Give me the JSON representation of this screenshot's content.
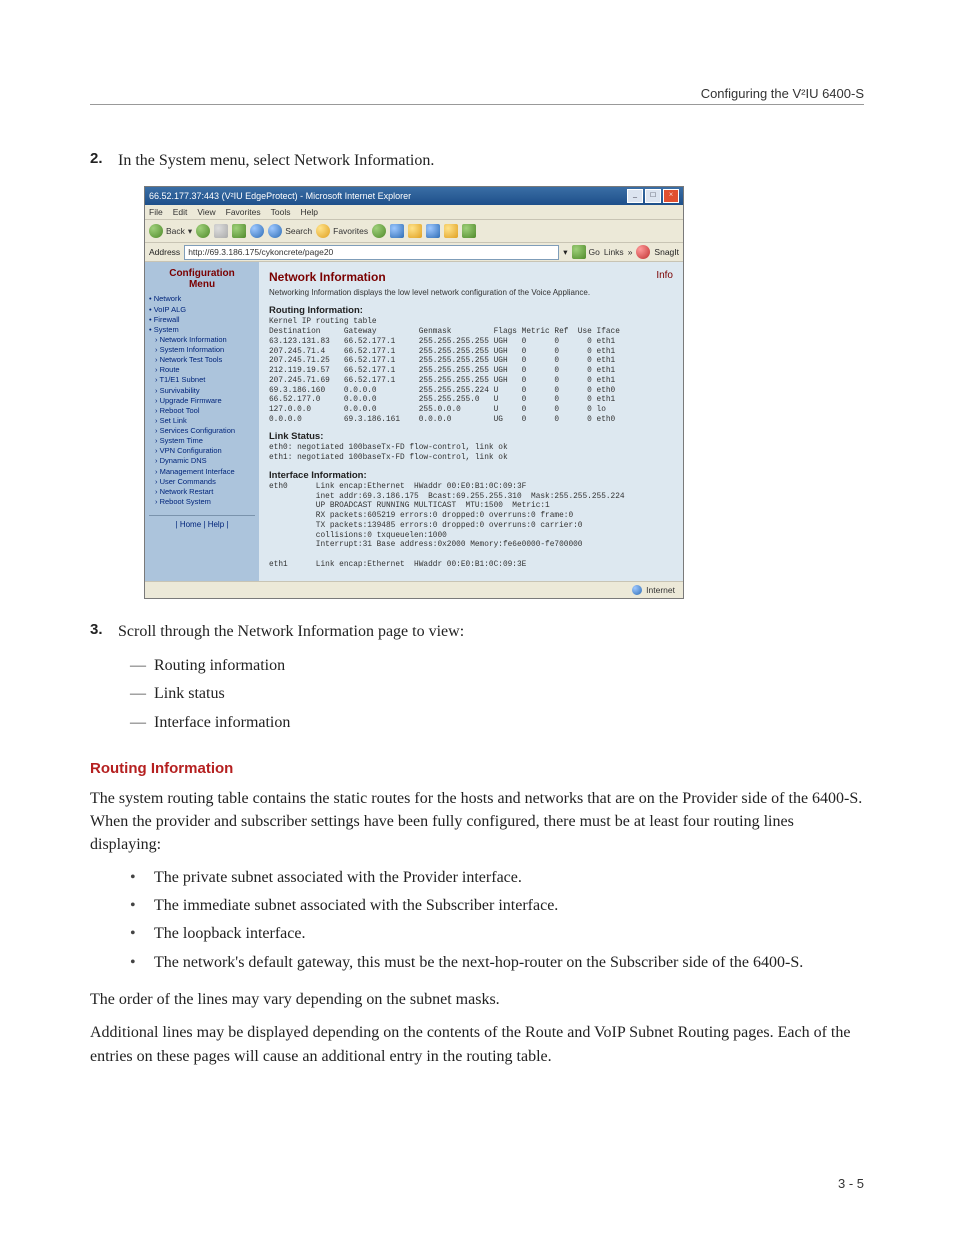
{
  "running_head": "Configuring the V²IU 6400-S",
  "step2": {
    "num": "2.",
    "text": "In the System menu, select Network Information."
  },
  "step3": {
    "num": "3.",
    "text": "Scroll through the Network Information page to view:"
  },
  "step3_items": [
    "Routing information",
    "Link status",
    "Interface information"
  ],
  "section_heading": "Routing Information",
  "para1": "The system routing table contains the static routes for the hosts and networks that are on the Provider side of the 6400-S. When the provider and subscriber settings have been fully configured, there must be at least four routing lines displaying:",
  "bullets": [
    "The private subnet associated with the Provider interface.",
    "The immediate subnet associated with the Subscriber interface.",
    "The loopback interface.",
    "The network's default gateway, this must be the next-hop-router on the Subscriber side of the 6400-S."
  ],
  "para2": "The order of the lines may vary depending on the subnet masks.",
  "para3": "Additional lines may be displayed depending on the contents of the Route and VoIP Subnet Routing pages. Each of the entries on these pages will cause an additional entry in the routing table.",
  "page_number": "3 - 5",
  "screenshot": {
    "titlebar": "66.52.177.37:443 (V²IU EdgeProtect) - Microsoft Internet Explorer",
    "menubar": [
      "File",
      "Edit",
      "View",
      "Favorites",
      "Tools",
      "Help"
    ],
    "toolbar": {
      "back": "Back",
      "search": "Search",
      "favorites": "Favorites"
    },
    "address_label": "Address",
    "address_url": "http://69.3.186.175/cykoncrete/page20",
    "go": "Go",
    "links": "Links",
    "snagit": "SnagIt",
    "sidebar": {
      "conf_head1": "Configuration",
      "conf_head2": "Menu",
      "items_top": [
        "Network",
        "VoIP ALG",
        "Firewall",
        "System"
      ],
      "items_sub": [
        "Network Information",
        "System Information",
        "Network Test Tools",
        "Route",
        "T1/E1 Subnet",
        "Survivability",
        "Upgrade Firmware",
        "Reboot Tool",
        "Set Link",
        "Services Configuration",
        "System Time",
        "VPN Configuration",
        "Dynamic DNS",
        "Management Interface",
        "User Commands",
        "Network Restart",
        "Reboot System"
      ],
      "bottom": "| Home | Help |"
    },
    "main": {
      "title": "Network Information",
      "info_link": "Info",
      "desc": "Networking Information displays the low level network configuration of the Voice Appliance.",
      "routing_head": "Routing Information:",
      "routing_pre": "Kernel IP routing table\nDestination     Gateway         Genmask         Flags Metric Ref  Use Iface\n63.123.131.83   66.52.177.1     255.255.255.255 UGH   0      0      0 eth1\n207.245.71.4    66.52.177.1     255.255.255.255 UGH   0      0      0 eth1\n207.245.71.25   66.52.177.1     255.255.255.255 UGH   0      0      0 eth1\n212.119.19.57   66.52.177.1     255.255.255.255 UGH   0      0      0 eth1\n207.245.71.69   66.52.177.1     255.255.255.255 UGH   0      0      0 eth1\n69.3.186.160    0.0.0.0         255.255.255.224 U     0      0      0 eth0\n66.52.177.0     0.0.0.0         255.255.255.0   U     0      0      0 eth1\n127.0.0.0       0.0.0.0         255.0.0.0       U     0      0      0 lo\n0.0.0.0         69.3.186.161    0.0.0.0         UG    0      0      0 eth0",
      "link_head": "Link Status:",
      "link_pre": "eth0: negotiated 100baseTx-FD flow-control, link ok\neth1: negotiated 100baseTx-FD flow-control, link ok",
      "iface_head": "Interface Information:",
      "iface_pre": "eth0      Link encap:Ethernet  HWaddr 00:E0:B1:0C:09:3F\n          inet addr:69.3.186.175  Bcast:69.255.255.310  Mask:255.255.255.224\n          UP BROADCAST RUNNING MULTICAST  MTU:1500  Metric:1\n          RX packets:605219 errors:0 dropped:0 overruns:0 frame:0\n          TX packets:139485 errors:0 dropped:0 overruns:0 carrier:0\n          collisions:0 txqueuelen:1000\n          Interrupt:31 Base address:0x2000 Memory:fe6e0000-fe700000\n\neth1      Link encap:Ethernet  HWaddr 00:E0:B1:0C:09:3E",
      "statusbar": "Internet"
    }
  }
}
